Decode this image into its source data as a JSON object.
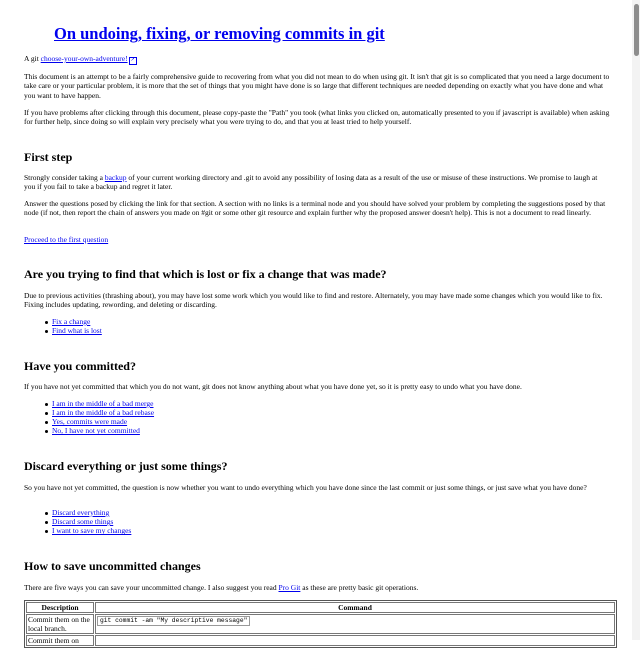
{
  "title": "On undoing, fixing, or removing commits in git",
  "intro": {
    "lead": "A git ",
    "link": "choose-your-own-adventure!",
    "paragraph1": "This document is an attempt to be a fairly comprehensive guide to recovering from what you did not mean to do when using git. It isn't that git is so complicated that you need a large document to take care or your particular problem, it is more that the set of things that you might have done is so large that different techniques are needed depending on exactly what you have done and what you want to have happen.",
    "paragraph2": "If you have problems after clicking through this document, please copy-paste the \"Path\" you took (what links you clicked on, automatically presented to you if javascript is available) when asking for further help, since doing so will explain very precisely what you were trying to do, and that you at least tried to help yourself."
  },
  "first_step": {
    "heading": "First step",
    "p1_before": "Strongly consider taking a ",
    "p1_link": "backup",
    "p1_after": " of your current working directory and .git to avoid any possibility of losing data as a result of the use or misuse of these instructions. We promise to laugh at you if you fail to take a backup and regret it later.",
    "p2": "Answer the questions posed by clicking the link for that section. A section with no links is a terminal node and you should have solved your problem by completing the suggestions posed by that node (if not, then report the chain of answers you made on #git or some other git resource and explain further why the proposed answer doesn't help). This is not a document to read linearly.",
    "proceed_link": "Proceed to the first question"
  },
  "lost_or_fix": {
    "heading": "Are you trying to find that which is lost or fix a change that was made?",
    "text": "Due to previous activities (thrashing about), you may have lost some work which you would like to find and restore. Alternately, you may have made some changes which you would like to fix. Fixing includes updating, rewording, and deleting or discarding.",
    "links": [
      "Fix a change",
      "Find what is lost"
    ]
  },
  "committed": {
    "heading": "Have you committed?",
    "text": "If you have not yet committed that which you do not want, git does not know anything about what you have done yet, so it is pretty easy to undo what you have done.",
    "links": [
      "I am in the middle of a bad merge",
      "I am in the middle of a bad rebase",
      "Yes, commits were made",
      "No, I have not yet committed"
    ]
  },
  "discard": {
    "heading": "Discard everything or just some things?",
    "text": "So you have not yet committed, the question is now whether you want to undo everything which you have done since the last commit or just some things, or just save what you have done?",
    "links": [
      "Discard everything",
      "Discard some things",
      "I want to save my changes"
    ]
  },
  "save_changes": {
    "heading": "How to save uncommitted changes",
    "text_before": "There are five ways you can save your uncommitted change. I also suggest you read ",
    "text_link": "Pro Git",
    "text_after": " as these are pretty basic git operations.",
    "table": {
      "headers": [
        "Description",
        "Command"
      ],
      "rows": [
        {
          "description": "Commit them on the local branch.",
          "command": "git commit -am \"My descriptive message\""
        },
        {
          "description": "Commit them on",
          "command": ""
        }
      ]
    }
  }
}
